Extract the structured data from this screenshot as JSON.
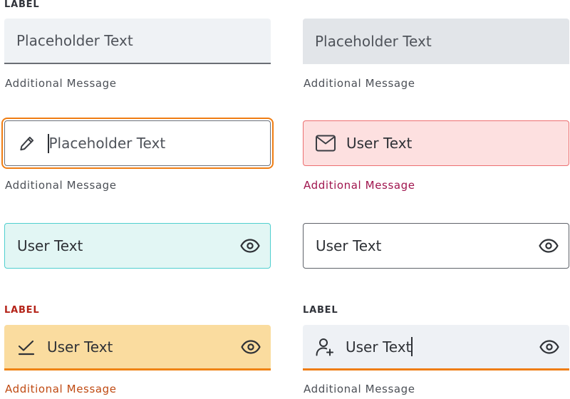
{
  "colors": {
    "focus_ring": "#ef7d13",
    "error_fill": "#fde0e0",
    "error_border": "#ec6f70",
    "error_message": "#a0154e",
    "success_fill": "#e2f6f4",
    "success_border": "#4fcfcf",
    "warning_fill": "#fadc9f",
    "warning_border": "#ef8314",
    "warning_text": "#c04a12",
    "label_error": "#b42318"
  },
  "fields": {
    "f1": {
      "label": "LABEL",
      "placeholder": "Placeholder Text",
      "message": "Additional Message"
    },
    "f2": {
      "placeholder": "Placeholder Text",
      "message": "Additional Message"
    },
    "f3": {
      "icon": "pencil-icon",
      "placeholder": "Placeholder Text",
      "message": "Additional Message"
    },
    "f4": {
      "icon": "mail-icon",
      "value": "User Text",
      "message": "Additional Message"
    },
    "f5": {
      "value": "User Text",
      "trailing_icon": "eye-icon"
    },
    "f6": {
      "value": "User Text",
      "trailing_icon": "eye-icon"
    },
    "f7": {
      "label": "LABEL",
      "icon": "check-icon",
      "value": "User Text",
      "trailing_icon": "eye-icon",
      "message": "Additional Message"
    },
    "f8": {
      "label": "LABEL",
      "icon": "user-add-icon",
      "value": "User Text",
      "trailing_icon": "eye-icon",
      "message": "Additional Message"
    }
  }
}
